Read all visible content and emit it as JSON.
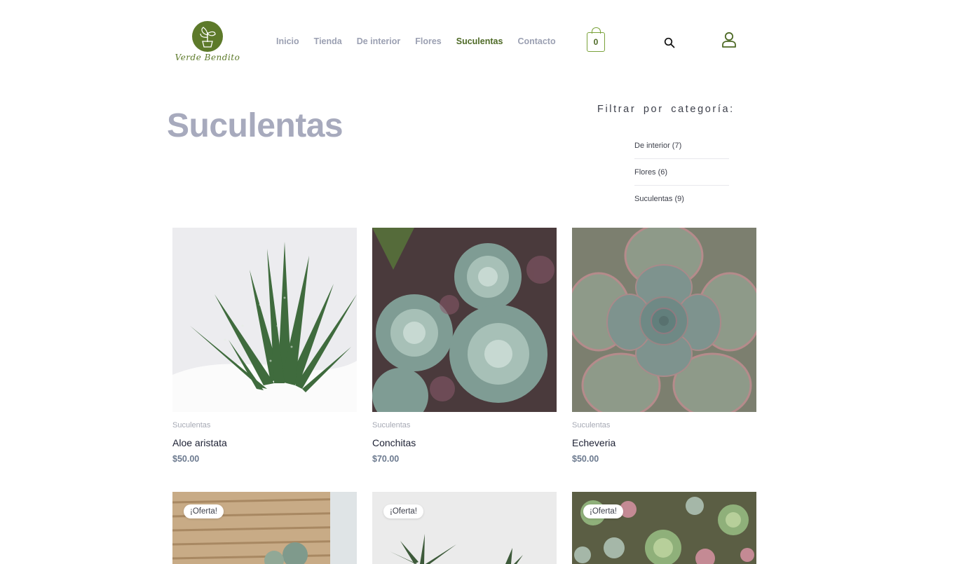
{
  "brand": {
    "logo_text": "Verde Bendito"
  },
  "nav": {
    "items": [
      {
        "label": "Inicio"
      },
      {
        "label": "Tienda"
      },
      {
        "label": "De interior"
      },
      {
        "label": "Flores"
      },
      {
        "label": "Suculentas",
        "active": true
      },
      {
        "label": "Contacto"
      }
    ]
  },
  "cart": {
    "count": "0"
  },
  "icons": {
    "search": "search-icon",
    "account": "user-icon",
    "cart": "shopping-bag-icon"
  },
  "colors": {
    "brand_green": "#5d7a2a",
    "title_gray": "#a7aabd",
    "price_gray": "#6c7a8f"
  },
  "page": {
    "title": "Suculentas"
  },
  "filter": {
    "heading": "Filtrar por categoría:",
    "items": [
      {
        "label": "De interior (7)"
      },
      {
        "label": "Flores (6)"
      },
      {
        "label": "Suculentas (9)"
      }
    ]
  },
  "products": [
    {
      "category": "Suculentas",
      "name": "Aloe aristata",
      "price": "$50.00"
    },
    {
      "category": "Suculentas",
      "name": "Conchitas",
      "price": "$70.00"
    },
    {
      "category": "Suculentas",
      "name": "Echeveria",
      "price": "$50.00"
    }
  ],
  "products_row2": [
    {
      "badge": "¡Oferta!"
    },
    {
      "badge": "¡Oferta!"
    },
    {
      "badge": "¡Oferta!"
    }
  ]
}
